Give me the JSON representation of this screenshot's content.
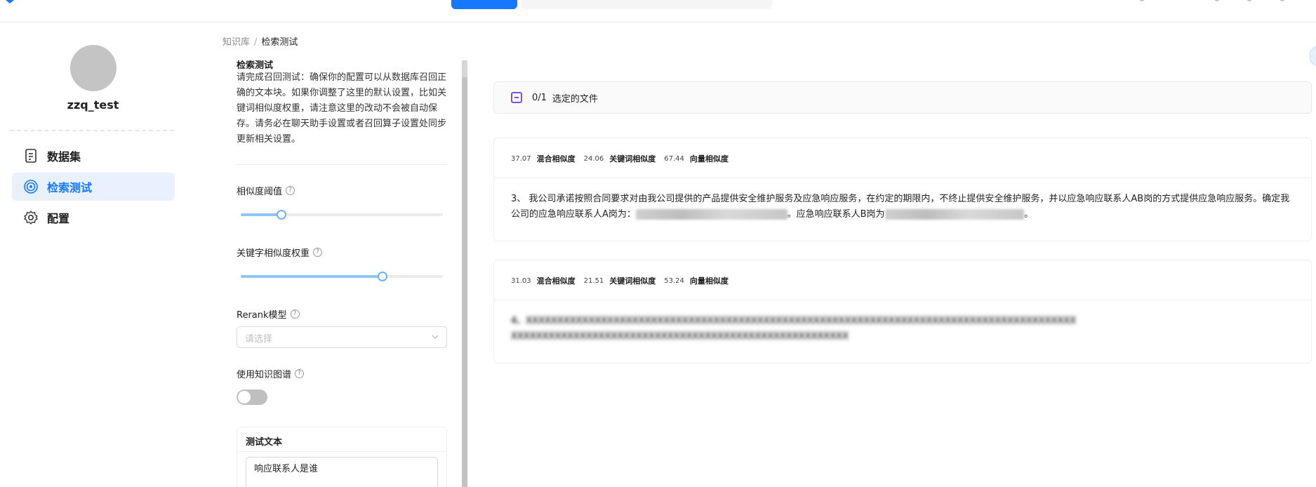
{
  "sidebar": {
    "username": "zzq_test",
    "items": [
      {
        "label": "数据集",
        "icon": "document-icon"
      },
      {
        "label": "检索测试",
        "icon": "target-icon"
      },
      {
        "label": "配置",
        "icon": "gear-icon"
      }
    ]
  },
  "breadcrumb": {
    "root": "知识库",
    "separator": "/",
    "current": "检索测试"
  },
  "settings": {
    "title": "检索测试",
    "description": "请完成召回测试：确保你的配置可以从数据库召回正确的文本块。如果你调整了这里的默认设置，比如关键词相似度权重，请注意这里的改动不会被自动保存。请务必在聊天助手设置或者召回算子设置处同步更新相关设置。",
    "similarity_threshold": {
      "label": "相似度阈值",
      "value_fraction": 0.2
    },
    "keyword_weight": {
      "label": "关键字相似度权重",
      "value_fraction": 0.7
    },
    "rerank": {
      "label": "Rerank模型",
      "placeholder": "请选择"
    },
    "knowledge_graph": {
      "label": "使用知识图谱",
      "enabled": false
    },
    "test_text": {
      "header": "测试文本",
      "value": "响应联系人是谁"
    }
  },
  "selector": {
    "count": "0/1",
    "label": "选定的文件"
  },
  "results": [
    {
      "hybrid": "37.07",
      "hybrid_label": "混合相似度",
      "keyword": "24.06",
      "keyword_label": "关键词相似度",
      "vector": "67.44",
      "vector_label": "向量相似度",
      "text_a": "3、 我公司承诺按照合同要求对由我公司提供的产品提供安全维护服务及应急响应服务，在约定的期限内，不终止提供安全维护服务，并以应急响应联系人AB岗的方式提供应急响应服务。确定我公司的应急响应联系人A岗为：",
      "text_b": "。应急响应联系人B岗为",
      "text_c": "。"
    },
    {
      "hybrid": "31.03",
      "hybrid_label": "混合相似度",
      "keyword": "21.51",
      "keyword_label": "关键词相似度",
      "vector": "53.24",
      "vector_label": "向量相似度"
    }
  ],
  "colors": {
    "accent": "#1677ff",
    "active_bg": "#e8f1fd",
    "checkbox": "#7b4fd6"
  }
}
